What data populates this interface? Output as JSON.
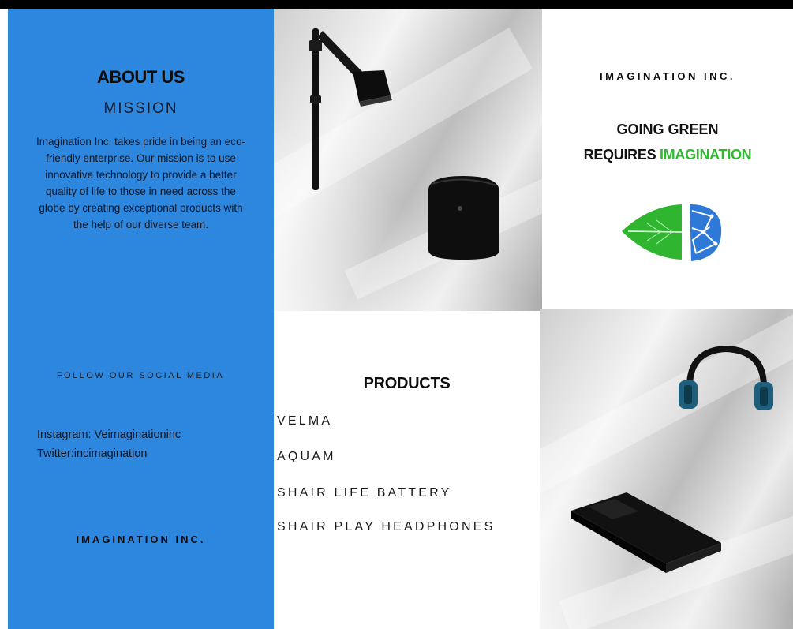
{
  "left": {
    "about_title": "ABOUT US",
    "mission_title": "MISSION",
    "mission_text": "Imagination Inc. takes pride in being an eco-friendly enterprise. Our mission is to use innovative technology to provide a better quality of life to those in need across the globe  by creating exceptional products with the help of our diverse team.",
    "follow_title": "FOLLOW OUR SOCIAL MEDIA",
    "instagram": "Instagram: Veimaginationinc",
    "twitter": "Twitter:incimagination",
    "brand": "IMAGINATION INC."
  },
  "right": {
    "brand": "IMAGINATION INC.",
    "headline_line1": "GOING GREEN",
    "headline_line2_prefix": "REQUIRES ",
    "headline_line2_accent": "IMAGINATION"
  },
  "products": {
    "title": "PRODUCTS",
    "items": [
      "VELMA",
      "AQUAM",
      "SHAIR LIFE BATTERY",
      "SHAIR PLAY HEADPHONES"
    ]
  },
  "colors": {
    "panel_blue": "#2e87df",
    "accent_green": "#2dbb2d"
  },
  "icons": [
    "shower-head-icon",
    "water-tank-icon",
    "headphones-icon",
    "battery-pack-icon",
    "leaf-brain-logo-icon"
  ]
}
